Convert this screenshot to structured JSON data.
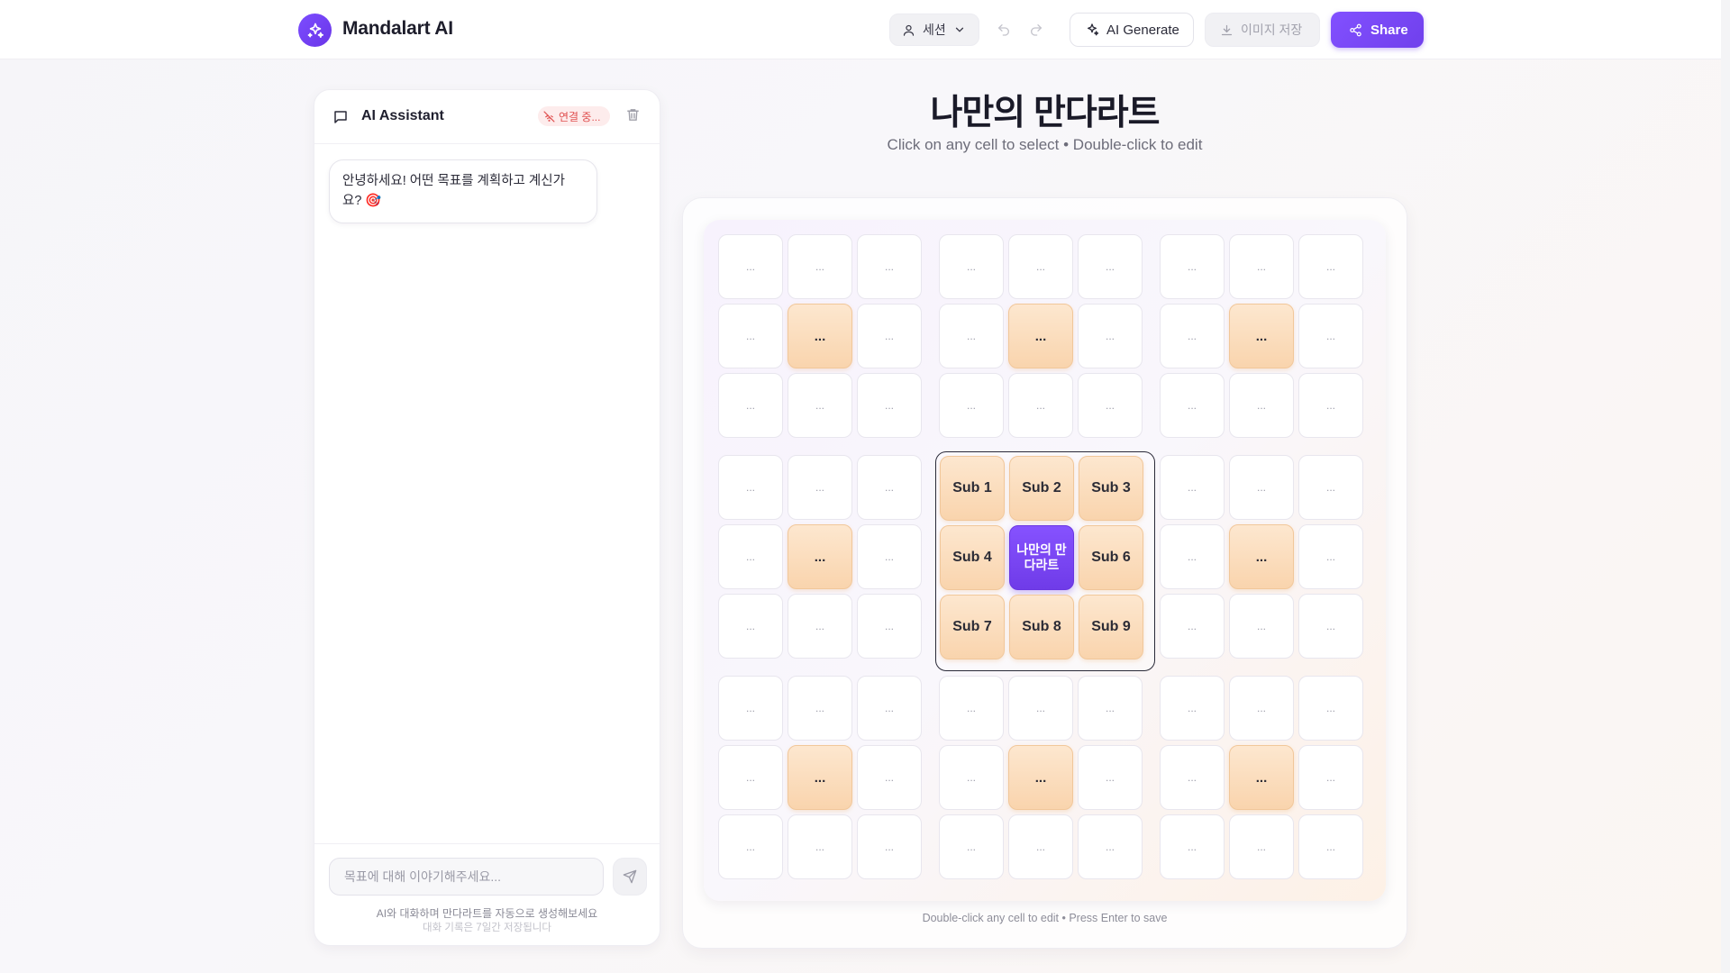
{
  "header": {
    "app_name": "Mandalart AI",
    "session_label": "세션",
    "ai_generate_label": "AI Generate",
    "save_image_label": "이미지 저장",
    "share_label": "Share"
  },
  "chat": {
    "title": "AI Assistant",
    "connection_status": "연결 중...",
    "messages": [
      {
        "role": "assistant",
        "text": "안녕하세요! 어떤 목표를 계획하고 계신가요? 🎯"
      }
    ],
    "input_placeholder": "목표에 대해 이야기해주세요...",
    "hint_primary": "AI와 대화하며 만다라트를 자동으로 생성해보세요",
    "hint_secondary": "대화 기록은 7일간 저장됩니다"
  },
  "board": {
    "title": "나만의 만다라트",
    "subtitle": "Click on any cell to select • Double-click to edit",
    "footer_hint": "Double-click any cell to edit • Press Enter to save",
    "core_goal": "나만의 만다라트",
    "sub_goals": [
      "Sub 1",
      "Sub 2",
      "Sub 3",
      "Sub 4",
      "Sub 6",
      "Sub 7",
      "Sub 8",
      "Sub 9"
    ],
    "empty_cell_text": "...",
    "colors": {
      "core": "#7c4dff",
      "subgoal": "#fbdcbb",
      "accent": "#7040ec"
    }
  },
  "icons": {
    "logo": "sparkles-icon",
    "session": "user-icon",
    "undo": "undo-icon",
    "redo": "redo-icon",
    "ai_generate": "sparkles-icon",
    "save_image": "download-icon",
    "share": "share-icon",
    "chat": "message-square-icon",
    "connection": "wifi-off-icon",
    "trash": "trash-icon",
    "send": "send-icon"
  }
}
